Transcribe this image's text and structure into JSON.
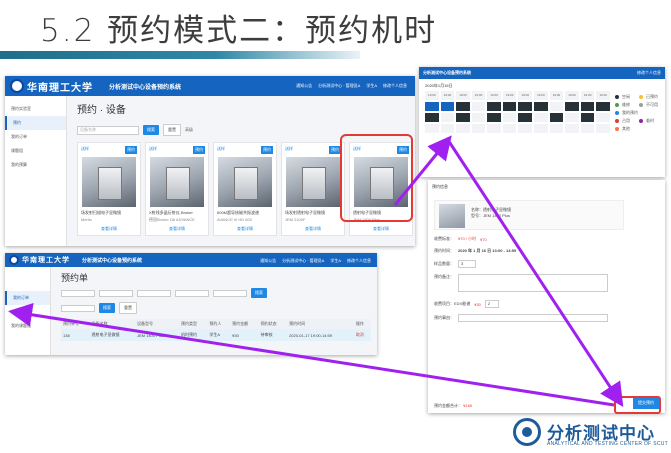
{
  "slide": {
    "title": "5.2 预约模式二：预约机时"
  },
  "app": {
    "logo_text": "华南理工大学",
    "system_title": "分析测试中心设备预约系统",
    "nav": [
      "通知公告",
      "分析测试中心 · 管理员A",
      "学生A",
      "修改个人信息"
    ]
  },
  "devices_page": {
    "sidebar": [
      "预约实验室",
      "预约",
      "我的订单",
      "课题组",
      "我的预算"
    ],
    "heading": "预约 · 设备",
    "search_placeholder": "设备名称",
    "search_label": "搜索",
    "reset_label": "重置",
    "extra_label": "高级",
    "cards": [
      {
        "tag": "送样",
        "book": "预约",
        "name": "场发射扫描电子显微镜",
        "model": "Merlin",
        "detail": "查看详情"
      },
      {
        "tag": "送样",
        "book": "预约",
        "name": "X射线多晶衍射仪-Bruker",
        "model": "德国Bruker D8 ADVANCE",
        "detail": "查看详情"
      },
      {
        "tag": "送样",
        "book": "预约",
        "name": "600M超导核磁共振波谱",
        "model": "AVANCE III HD 600",
        "detail": "查看详情"
      },
      {
        "tag": "送样",
        "book": "预约",
        "name": "场发射透射电子显微镜",
        "model": "JEM 2100F",
        "detail": "查看详情"
      },
      {
        "tag": "送样",
        "book": "预约",
        "name": "透射电子显微镜",
        "model": "JEM 1400 Plus",
        "detail": "查看详情"
      }
    ]
  },
  "orders_page": {
    "sidebar": [
      "我的订单",
      "课题组",
      "我的课题组"
    ],
    "heading": "预约单",
    "search_label": "搜索",
    "reset_label": "重置",
    "columns": [
      "预约单号",
      "设备名称",
      "设备型号",
      "预约类型",
      "预约人",
      "预约金额",
      "预约状态",
      "预约时间",
      "操作"
    ],
    "rows": [
      [
        "138",
        "透射电子显微镜",
        "JEM 1400 Plus",
        "机时预约",
        "学生A",
        "¥30",
        "待审核",
        "2020-01-17 19:00-14:59",
        "取消"
      ]
    ]
  },
  "slots_page": {
    "date_label": "2020年1月16日",
    "legend": [
      "空闲",
      "已预约",
      "维修",
      "不可用",
      "我的预约",
      "占用",
      "临时",
      "其他"
    ],
    "slot_time": "19:00"
  },
  "booking_form": {
    "head": "预约信息",
    "device_name": "名称：透射电子显微镜",
    "device_model": "型号：JEM 1400 Plus",
    "fee_label": "收费标准：",
    "fee_value": "¥70 / 小时",
    "fee_value2": "¥70",
    "time_label": "预约时间：",
    "time_value": "2020 年 1 月 16 日  13:00 - 14:59",
    "samples_label": "样品数量：",
    "samples_value": "3",
    "remark_label": "预约备注：",
    "service_label": "收费项目：EDX能谱",
    "service_price": "¥30",
    "service_qty": "2",
    "note_label": "预约事由：",
    "total_label": "预约金额合计：",
    "total_value": "¥165",
    "submit_label": "提交预约"
  },
  "brand": {
    "name": "分析测试中心",
    "name_en": "ANALYTICAL AND TESTING CENTER OF SCUT"
  },
  "colors": {
    "header_blue": "#1565c0",
    "highlight_red": "#e53935",
    "arrow_purple": "#a020f0"
  }
}
